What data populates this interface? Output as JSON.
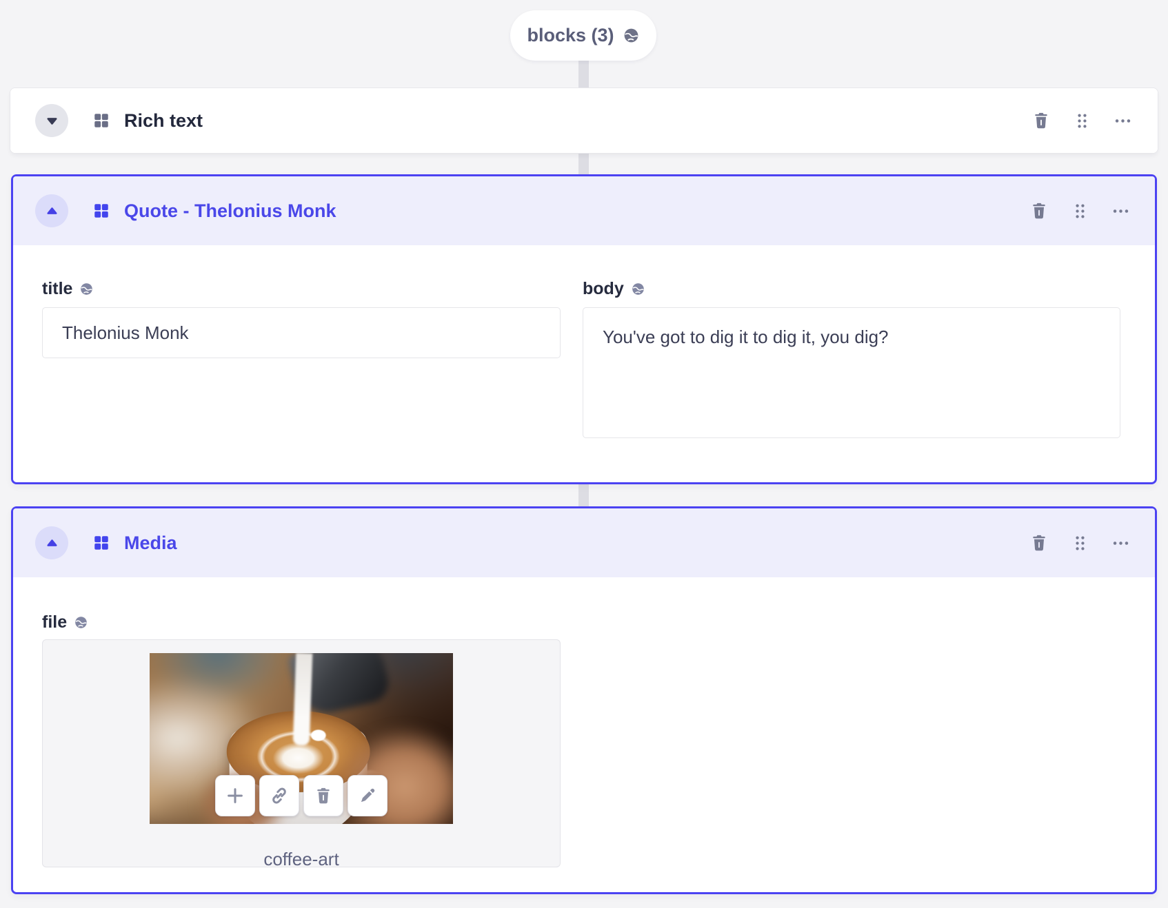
{
  "pill": {
    "label": "blocks (3)",
    "icon": "globe-icon"
  },
  "colors": {
    "accent": "#4B42F2",
    "selected_header_bg": "#EEEEFC",
    "selected_title": "#4A47E9",
    "page_bg": "#F4F4F6",
    "icon_slate": "#767A91",
    "connector": "#DDDDE3"
  },
  "blocks": [
    {
      "name": "Rich text",
      "collapsed": true,
      "actions": [
        "delete",
        "drag",
        "more-options"
      ]
    },
    {
      "name": "Quote - Thelonius Monk",
      "collapsed": false,
      "actions": [
        "delete",
        "drag",
        "more-options"
      ],
      "fields": {
        "title": {
          "label": "title",
          "localized": true,
          "value": "Thelonius Monk"
        },
        "body": {
          "label": "body",
          "localized": true,
          "value": "You've got to dig it to dig it, you dig?"
        }
      }
    },
    {
      "name": "Media",
      "collapsed": false,
      "actions": [
        "delete",
        "drag",
        "more-options"
      ],
      "fields": {
        "file": {
          "label": "file",
          "localized": true,
          "filename": "coffee-art",
          "toolbar": [
            "plus",
            "link",
            "trash",
            "edit"
          ]
        }
      }
    }
  ]
}
